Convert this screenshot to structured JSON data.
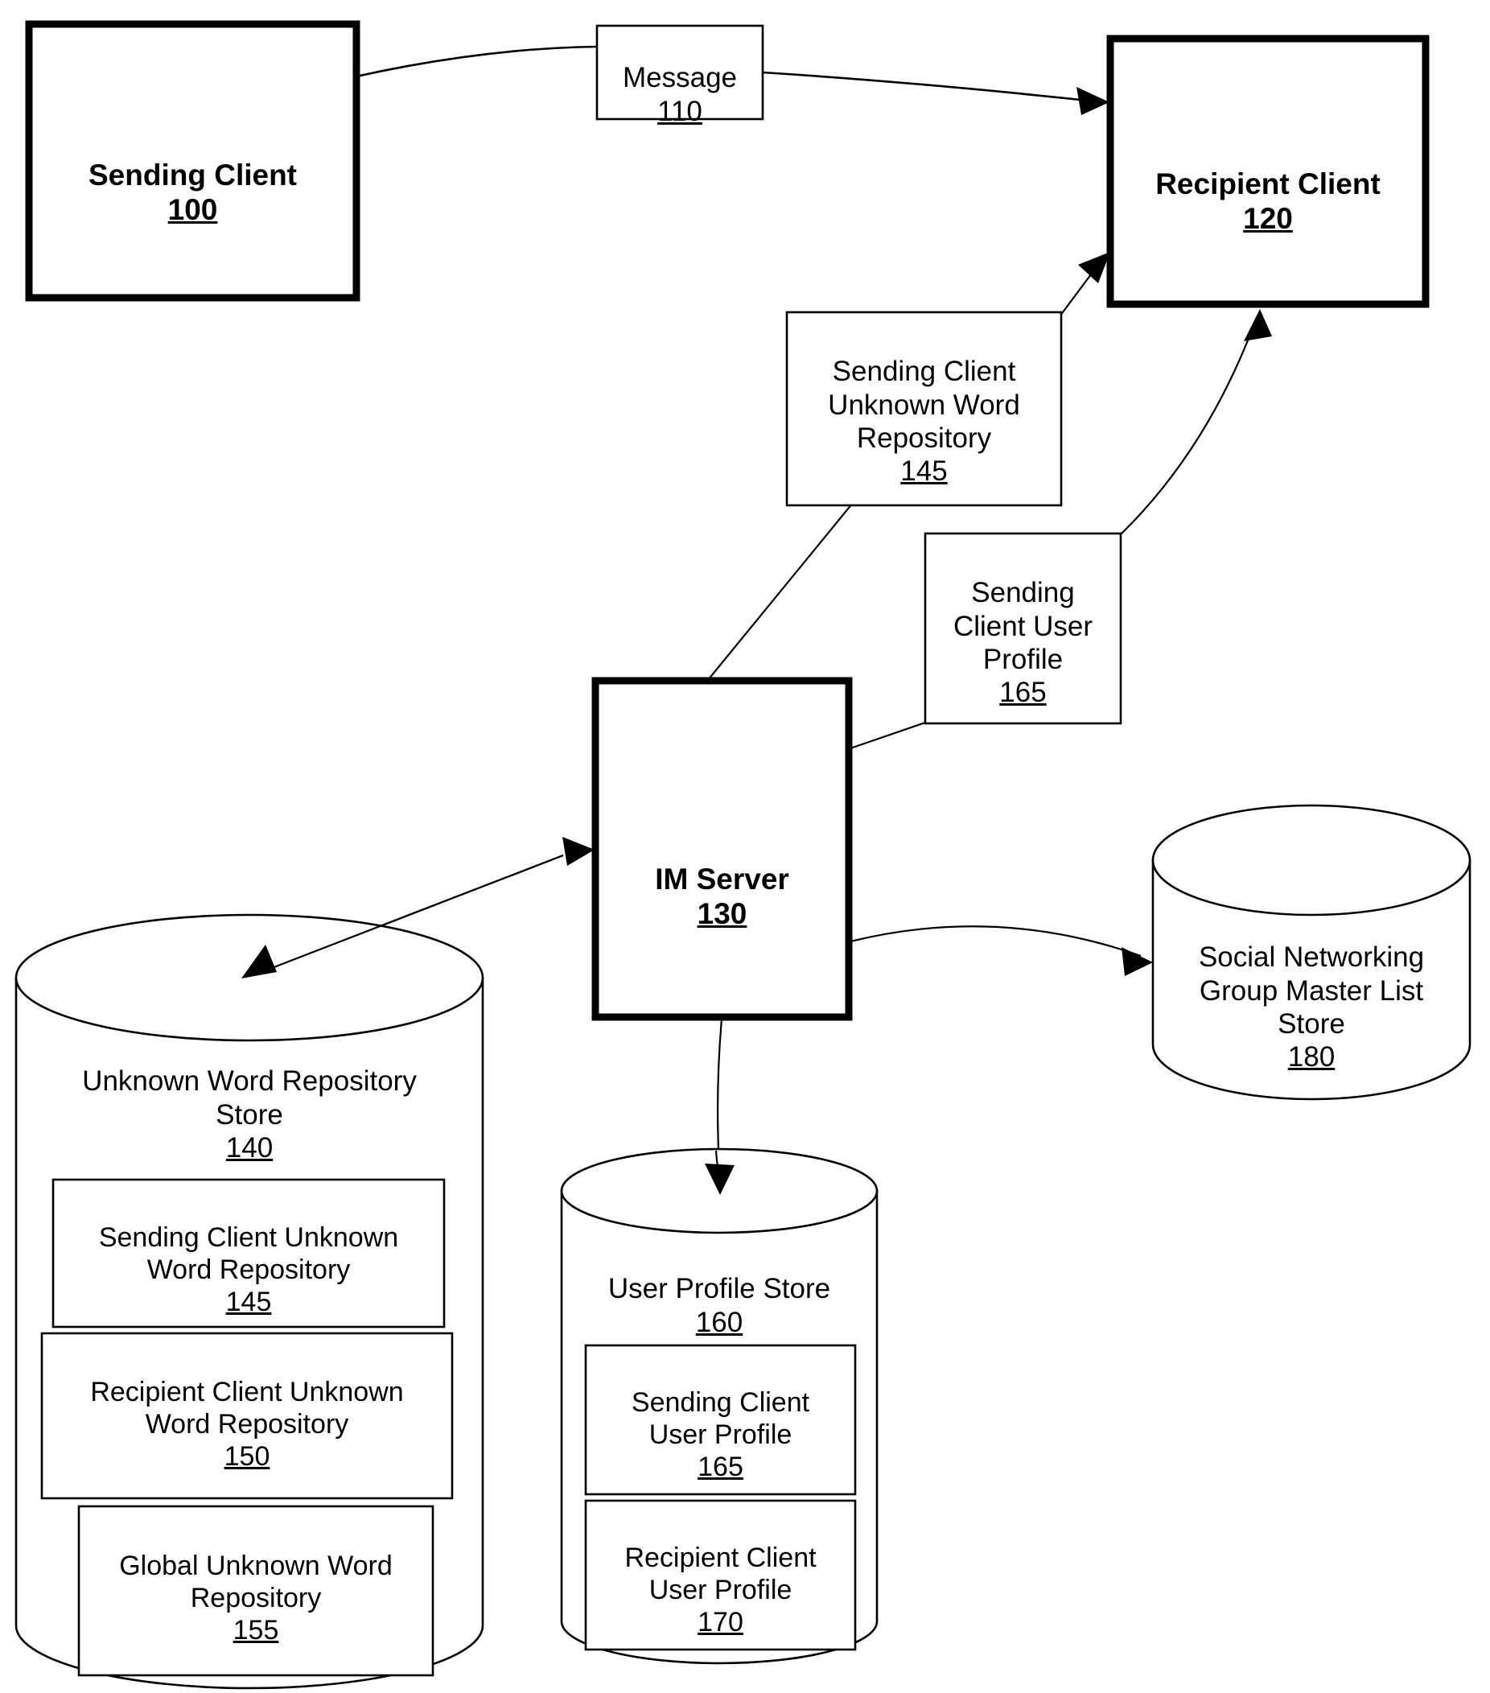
{
  "figure": {
    "type": "patent-block-diagram",
    "background_color": "#ffffff",
    "line_color": "#000000"
  },
  "nodes": {
    "sending_client": {
      "title": "Sending Client",
      "ref": "100",
      "shape": "rect-thick"
    },
    "message": {
      "title": "Message",
      "ref": "110",
      "shape": "rect-thin"
    },
    "recipient_client": {
      "title": "Recipient Client",
      "ref": "120",
      "shape": "rect-thick"
    },
    "sending_client_unknown_word_repository": {
      "title": "Sending Client\nUnknown Word\nRepository",
      "ref": "145",
      "shape": "rect-thin"
    },
    "sending_client_user_profile": {
      "title": "Sending\nClient User\nProfile",
      "ref": "165",
      "shape": "rect-thin"
    },
    "im_server": {
      "title": "IM Server",
      "ref": "130",
      "shape": "rect-thick"
    },
    "unknown_word_repository_store": {
      "title": "Unknown Word Repository\nStore",
      "ref": "140",
      "shape": "cylinder"
    },
    "uwrs_item_145": {
      "title": "Sending Client Unknown\nWord Repository",
      "ref": "145",
      "shape": "rect-thin"
    },
    "uwrs_item_150": {
      "title": "Recipient Client Unknown\nWord Repository",
      "ref": "150",
      "shape": "rect-thin"
    },
    "uwrs_item_155": {
      "title": "Global Unknown Word\nRepository",
      "ref": "155",
      "shape": "rect-thin"
    },
    "user_profile_store": {
      "title": "User Profile Store",
      "ref": "160",
      "shape": "cylinder"
    },
    "ups_item_165": {
      "title": "Sending Client\nUser Profile",
      "ref": "165",
      "shape": "rect-thin"
    },
    "ups_item_170": {
      "title": "Recipient Client\nUser Profile",
      "ref": "170",
      "shape": "rect-thin"
    },
    "social_networking_group_master_list_store": {
      "title": "Social Networking\nGroup Master List\nStore",
      "ref": "180",
      "shape": "cylinder"
    }
  },
  "connections": [
    {
      "id": "sending-client-to-recipient-client",
      "from": "sending_client",
      "to": "recipient_client",
      "via": "message",
      "arrowheads": "end"
    },
    {
      "id": "scuwr-145-to-recipient-client",
      "from": "sending_client_unknown_word_repository",
      "to": "recipient_client",
      "arrowheads": "end"
    },
    {
      "id": "scup-165-to-recipient-client",
      "from": "sending_client_user_profile",
      "to": "recipient_client",
      "arrowheads": "end"
    },
    {
      "id": "im-server-to-scuwr-145",
      "from": "im_server",
      "to": "sending_client_unknown_word_repository",
      "arrowheads": "none"
    },
    {
      "id": "im-server-to-scup-165",
      "from": "im_server",
      "to": "sending_client_user_profile",
      "arrowheads": "none"
    },
    {
      "id": "im-server-to-unknown-word-repository-store",
      "from": "im_server",
      "to": "unknown_word_repository_store",
      "arrowheads": "both"
    },
    {
      "id": "im-server-to-user-profile-store",
      "from": "im_server",
      "to": "user_profile_store",
      "arrowheads": "end"
    },
    {
      "id": "im-server-to-social-networking-store",
      "from": "im_server",
      "to": "social_networking_group_master_list_store",
      "arrowheads": "end"
    }
  ]
}
